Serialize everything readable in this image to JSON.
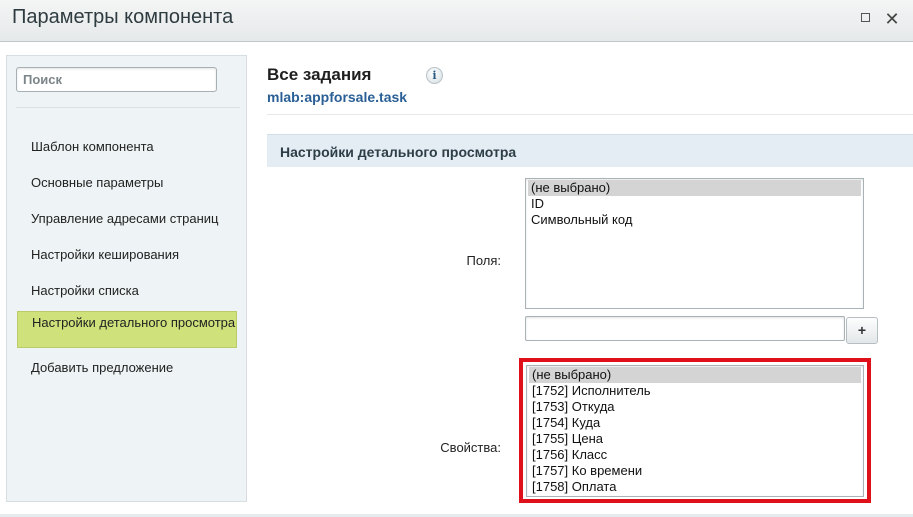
{
  "window": {
    "title": "Параметры компонента",
    "maximize_icon": "maximize-icon",
    "close_icon": "close-icon",
    "close_glyph": "✕"
  },
  "sidebar": {
    "search": {
      "placeholder": "Поиск",
      "value": ""
    },
    "items": [
      {
        "label": "Шаблон компонента",
        "active": false
      },
      {
        "label": "Основные параметры",
        "active": false
      },
      {
        "label": "Управление адресами страниц",
        "active": false
      },
      {
        "label": "Настройки кеширования",
        "active": false
      },
      {
        "label": "Настройки списка",
        "active": false
      },
      {
        "label": "Настройки детального просмотра",
        "active": true
      },
      {
        "label": "Добавить предложение",
        "active": false
      }
    ]
  },
  "header": {
    "title": "Все задания",
    "subtitle": "mlab:appforsale.task",
    "info_glyph": "i"
  },
  "section": {
    "title": "Настройки детального просмотра"
  },
  "fields": {
    "label": "Поля:",
    "options": [
      "(не выбрано)",
      "ID",
      "Символьный код"
    ],
    "selected_index": 0,
    "custom_input_value": "",
    "add_button_label": "+"
  },
  "properties": {
    "label": "Свойства:",
    "options": [
      "(не выбрано)",
      "[1752] Исполнитель",
      "[1753] Откуда",
      "[1754] Куда",
      "[1755] Цена",
      "[1756] Класс",
      "[1757] Ко времени",
      "[1758] Оплата"
    ],
    "selected_index": 0,
    "highlight_color": "#e0101a"
  },
  "colors": {
    "active_item_bg": "#cfe17a",
    "link": "#2a5f96",
    "section_bg": "#e3edf3"
  }
}
